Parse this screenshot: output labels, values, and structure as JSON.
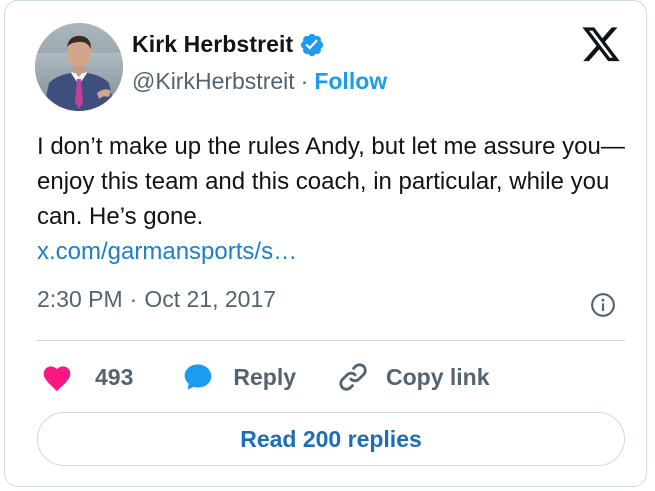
{
  "author": {
    "name": "Kirk Herbstreit",
    "handle": "@KirkHerbstreit",
    "separator": "·",
    "follow_label": "Follow"
  },
  "tweet": {
    "text": "I don’t make up the rules Andy, but let me assure you—enjoy this team and this coach, in particular, while you can. He’s gone.",
    "link": "x.com/garmansports/s…",
    "time": "2:30 PM",
    "separator": "·",
    "date": "Oct 21, 2017"
  },
  "actions": {
    "like_count": "493",
    "reply_label": "Reply",
    "copy_link_label": "Copy link"
  },
  "read_replies_label": "Read 200 replies",
  "icons": {
    "verified": "verified-badge-icon",
    "logo": "x-logo-icon",
    "info": "info-icon",
    "like": "heart-icon",
    "reply": "speech-bubble-icon",
    "copy": "link-icon"
  },
  "colors": {
    "accent": "#1d9bf0",
    "like": "#f91880",
    "text": "#0f1419",
    "secondary": "#536471",
    "border": "#cfd9de"
  }
}
